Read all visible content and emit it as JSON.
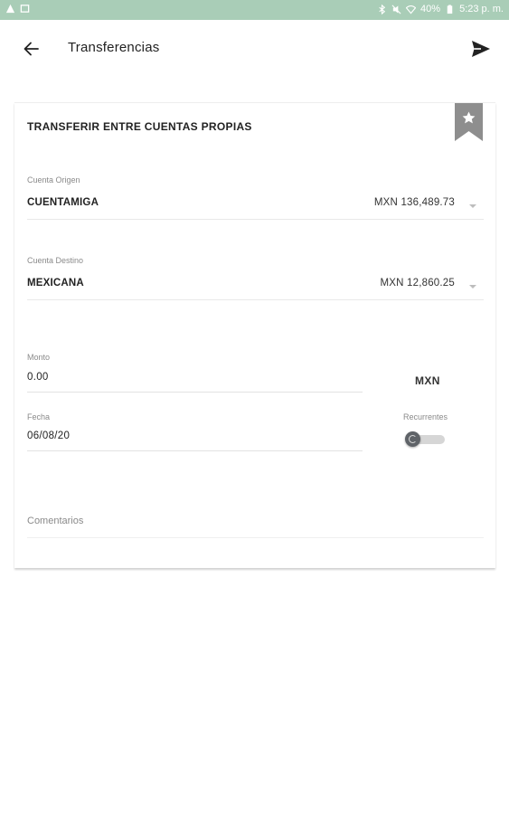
{
  "status_bar": {
    "left_icons": [
      "warning-icon",
      "notification-icon"
    ],
    "right_icons": [
      "bluetooth-icon",
      "mute-icon",
      "wifi-icon"
    ],
    "battery": "40%",
    "time": "5:23 p. m."
  },
  "toolbar": {
    "title": "Transferencias",
    "back_icon": "arrow-left-icon",
    "send_icon": "send-icon"
  },
  "card": {
    "title": "TRANSFERIR ENTRE CUENTAS PROPIAS",
    "bookmark_icon": "star-bookmark-icon",
    "origin": {
      "label": "Cuenta Origen",
      "account": "CUENTAMIGA",
      "balance": "MXN 136,489.73"
    },
    "destination": {
      "label": "Cuenta Destino",
      "account": "MEXICANA",
      "balance": "MXN 12,860.25"
    },
    "amount": {
      "label": "Monto",
      "value": "0.00",
      "currency": "MXN"
    },
    "date": {
      "label": "Fecha",
      "value": "06/08/20"
    },
    "recurring": {
      "label": "Recurrentes",
      "enabled": false
    },
    "comments": {
      "placeholder": "Comentarios"
    }
  },
  "colors": {
    "status_bar": "#a9cdb7",
    "bookmark": "#8e8e8e",
    "text_primary": "#222222",
    "text_secondary": "#8a8a8a"
  }
}
